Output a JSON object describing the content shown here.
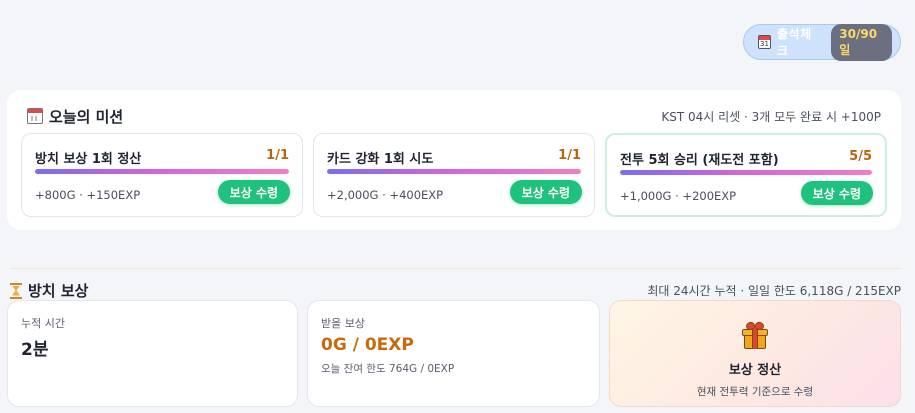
{
  "attendance": {
    "label": "출석체크",
    "badge": "30/90일"
  },
  "missions": {
    "title": "오늘의 미션",
    "note": "KST 04시 리셋 · 3개 모두 완료 시 +100P",
    "items": [
      {
        "name": "방치 보상 1회 정산",
        "count": "1/1",
        "progress": 1.0,
        "reward": "+800G · +150EXP",
        "button": "보상 수령"
      },
      {
        "name": "카드 강화 1회 시도",
        "count": "1/1",
        "progress": 1.0,
        "reward": "+2,000G · +400EXP",
        "button": "보상 수령"
      },
      {
        "name": "전투 5회 승리 (재도전 포함)",
        "count": "5/5",
        "progress": 1.0,
        "reward": "+1,000G · +200EXP",
        "button": "보상 수령"
      }
    ]
  },
  "idle": {
    "title": "방치 보상",
    "note": "최대 24시간 누적 · 일일 한도 6,118G / 215EXP",
    "accumulated_label": "누적 시간",
    "accumulated_value": "2분",
    "reward_label": "받을 보상",
    "reward_value": "0G / 0EXP",
    "reward_sub": "오늘 잔여 한도 764G / 0EXP",
    "claim_title": "보상 정산",
    "claim_sub": "현재 전투력 기준으로 수령"
  },
  "colors": {
    "accent_green": "#1ec27d",
    "gold": "#c8690e",
    "progress_gradient": [
      "#7b6cf0",
      "#d566d9",
      "#f27fc2"
    ]
  }
}
